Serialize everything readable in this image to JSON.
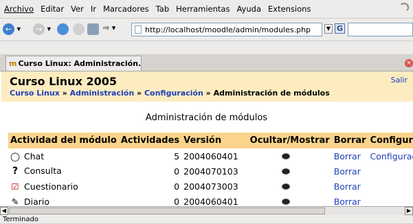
{
  "browser": {
    "menu": [
      {
        "label": "Archivo"
      },
      {
        "label": "Editar"
      },
      {
        "label": "Ver"
      },
      {
        "label": "Ir"
      },
      {
        "label": "Marcadores"
      },
      {
        "label": "Tab"
      },
      {
        "label": "Herramientas"
      },
      {
        "label": "Ayuda"
      },
      {
        "label": "Extensions"
      }
    ],
    "url": "http://localhost/moodle/admin/modules.php",
    "tab_title": "Curso Linux: Administración...",
    "status": "Terminado"
  },
  "page": {
    "course_title": "Curso Linux 2005",
    "logout_link": "Salir",
    "breadcrumb": {
      "course": "Curso Linux",
      "sep": "»",
      "admin": "Administración",
      "config": "Configuración",
      "current": "Administración de módulos"
    },
    "heading": "Administración de módulos"
  },
  "table": {
    "columns": [
      "Actividad del módulo",
      "Actividades",
      "Versión",
      "Ocultar/Mostrar",
      "Borrar",
      "Configuració"
    ],
    "rows": [
      {
        "icon": "chat-bubble-icon",
        "name": "Chat",
        "activities": "5",
        "version": "2004060401",
        "delete": "Borrar",
        "config": "Configuració"
      },
      {
        "icon": "question-mark-icon",
        "name": "Consulta",
        "activities": "0",
        "version": "2004070103",
        "delete": "Borrar",
        "config": ""
      },
      {
        "icon": "checkbox-icon",
        "name": "Cuestionario",
        "activities": "0",
        "version": "2004073003",
        "delete": "Borrar",
        "config": ""
      },
      {
        "icon": "journal-icon",
        "name": "Diario",
        "activities": "0",
        "version": "2004060401",
        "delete": "Borrar",
        "config": ""
      }
    ]
  },
  "colors": {
    "header_band": "#fcecc0",
    "table_header": "#f9d48a",
    "link": "#1f3fb8"
  }
}
